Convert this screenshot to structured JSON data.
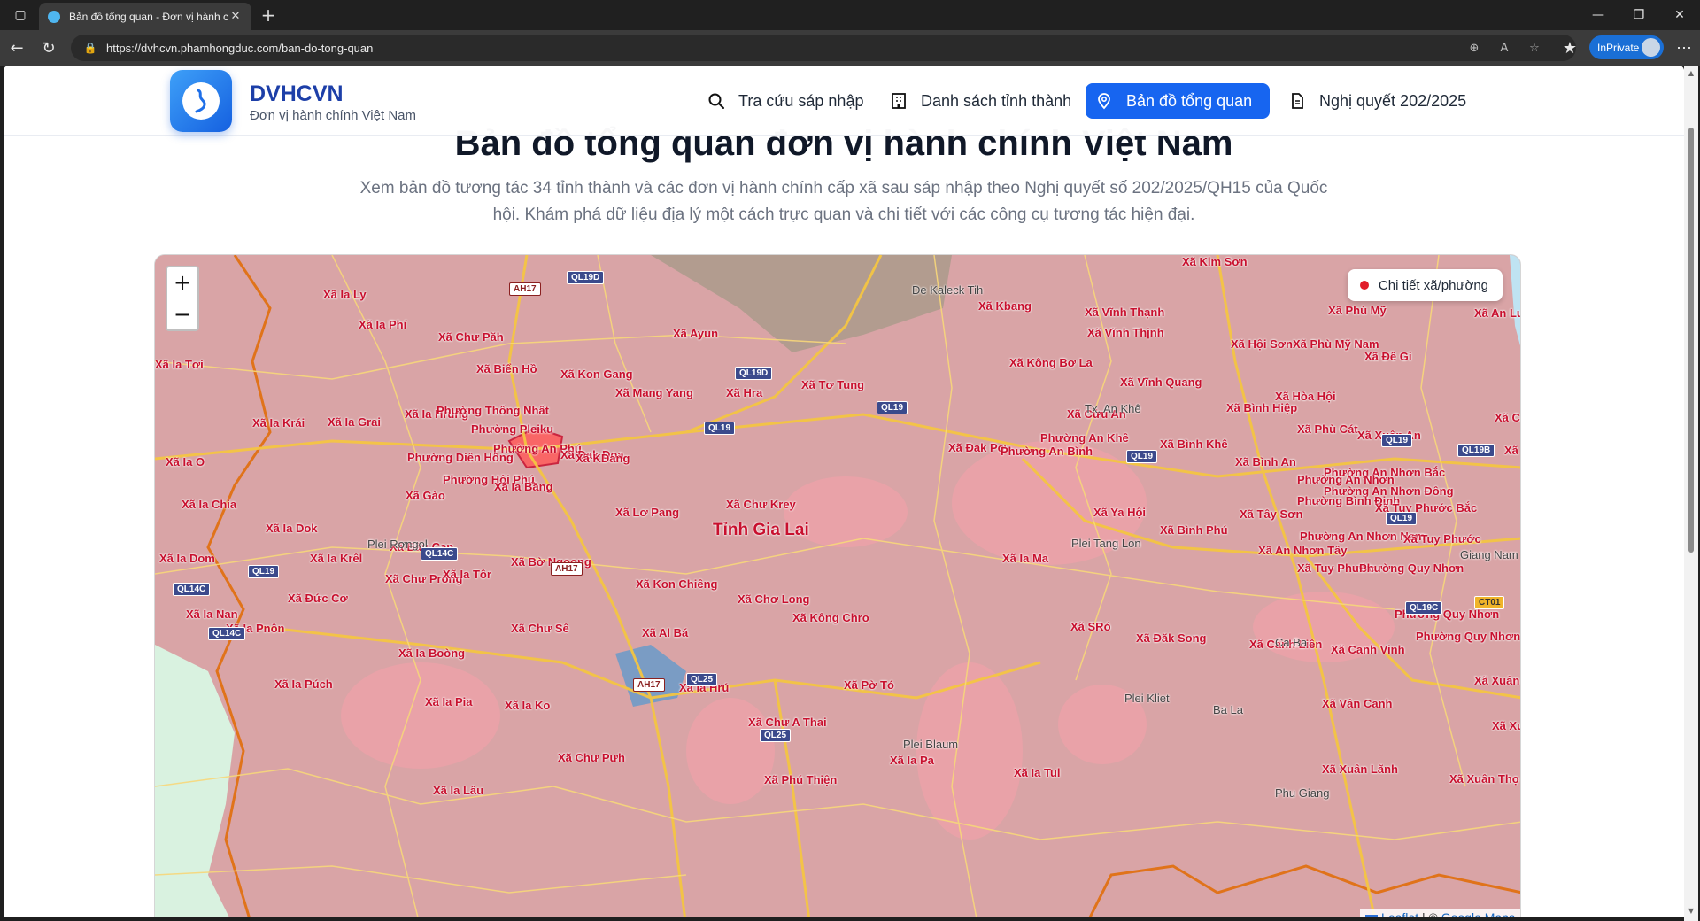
{
  "browser": {
    "tab_title": "Bản đồ tổng quan - Đơn vị hành c",
    "url": "https://dvhcvn.phamhongduc.com/ban-do-tong-quan",
    "inprivate_label": "InPrivate"
  },
  "header": {
    "brand_name": "DVHCVN",
    "brand_subtitle": "Đơn vị hành chính Việt Nam",
    "nav": [
      {
        "label": "Tra cứu sáp nhập",
        "icon": "search-icon"
      },
      {
        "label": "Danh sách tỉnh thành",
        "icon": "building-icon"
      },
      {
        "label": "Bản đồ tổng quan",
        "icon": "map-pin-icon",
        "active": true
      },
      {
        "label": "Nghị quyết 202/2025",
        "icon": "document-icon"
      }
    ],
    "accent_color": "#1765f0"
  },
  "hero": {
    "title": "Bản đồ tổng quan đơn vị hành chính Việt Nam",
    "description": "Xem bản đồ tương tác 34 tỉnh thành và các đơn vị hành chính cấp xã sau sáp nhập theo Nghị quyết số 202/2025/QH15 của Quốc hội. Khám phá dữ liệu địa lý một cách trực quan và chi tiết với các công cụ tương tác hiện đại."
  },
  "map": {
    "zoom_in": "+",
    "zoom_out": "−",
    "legend_label": "Chi tiết xã/phường",
    "attribution_leaflet": "Leaflet",
    "attribution_sep": "| ©",
    "attribution_google": "Google Maps",
    "province_label": "Tỉnh Gia Lai",
    "labels": [
      "Xã Kim Sơn",
      "De Kaleck Tih",
      "Xã Kbang",
      "Xã Vĩnh Thạnh",
      "Xã Phù Mỹ",
      "Xã An Lư",
      "Xã Ia Ly",
      "Xã Ia Phí",
      "Xã Chư Păh",
      "Xã Ayun",
      "Xã Vĩnh Thịnh",
      "Xã Hội Sơn",
      "Xã Phù Mỹ Nam",
      "Xã Đề Gi",
      "Xã Ia Tơi",
      "Xã Biển Hồ",
      "Xã Kon Gang",
      "Xã Kông Bơ La",
      "Xã Mang Yang",
      "Xã Hra",
      "Xã Tơ Tung",
      "Xã Vĩnh Quang",
      "Xã Hòa Hội",
      "Xã Ia Hrung",
      "Phường Thống Nhất",
      "Xã Bình Hiệp",
      "Xã Ia Krái",
      "Xã Ia Grai",
      "Phường Pleiku",
      "Xã Cửu An",
      "Xã Cát",
      "Phường An Khê",
      "Xã Phù Cát",
      "Xã Xuân An",
      "Xã Bình Khê",
      "Phường An Phú",
      "Xã Đak Đoa",
      "Xã Đak Pơ",
      "Phường An Bình",
      "Xã Ng",
      "Xã Ia O",
      "Phường Diên Hồng",
      "Xã KDang",
      "Xã Bình An",
      "Phường An Nhơn Bắc",
      "Phường Hội Phú",
      "Xã Ia Băng",
      "Phường An Nhơn",
      "Phường An Nhơn Đông",
      "Xã Gào",
      "Phường Bình Định",
      "Xã Tuy Phước Bắc",
      "Xã Ia Chia",
      "Xã Lơ Pang",
      "Xã Chư Krey",
      "Xã Ya Hội",
      "Xã Tây Sơn",
      "Xã Ia Dok",
      "Xã Bình Phú",
      "Phường An Nhơn Nam",
      "Xã Tuy Phước",
      "Xã Bàu Cạn",
      "Xã An Nhơn Tây",
      "Xã Ia Dom",
      "Xã Ia Krêl",
      "Xã Bờ Ngoong",
      "Xã Ia Ma",
      "Xã Tuy Phước",
      "Phường Quy Nhơn",
      "Xã Chư Prông",
      "Xã Ia Tôr",
      "Xã Kon Chiêng",
      "Xã Đức Cơ",
      "Xã Chơ Long",
      "Xã Kông Chro",
      "Phường Quy Nhơn",
      "Xã Ia Nan",
      "Xã Ia Pnôn",
      "Xã Chư Sê",
      "Xã Al Bá",
      "Xã SRó",
      "Xã Đăk Song",
      "Xã Canh Liên",
      "Xã Canh Vinh",
      "Phường Quy Nhơn Tây",
      "Xã Ia Boòng",
      "Xã Ia Púch",
      "Xã Pờ Tó",
      "Xã Ia Hrú",
      "Xã Xuân L",
      "Xã Ia Pia",
      "Xã Ia Ko",
      "Xã Chư A Thai",
      "Xã Vân Canh",
      "Xã Xuân",
      "Xã Chư Pưh",
      "Xã Ia Pa",
      "Xã Phú Thiện",
      "Xã Ia Tul",
      "Xã Xuân Lãnh",
      "Xã Xuân Thọ",
      "Xã Ia Lâu"
    ],
    "place_labels": [
      "Plei Rơngol",
      "Plei Tang Lon",
      "Plei Kliet",
      "Plei Blaum",
      "Phu Giang",
      "Ba La",
      "Ca Ba",
      "Tx. An Khê",
      "Giang Nam"
    ],
    "road_shields": [
      "AH17",
      "QL19D",
      "QL19D",
      "QL19",
      "QL19",
      "QL19",
      "QL19",
      "QL19B",
      "QL14C",
      "QL14C",
      "QL14C",
      "QL19",
      "AH17",
      "QL25",
      "AH17",
      "QL25",
      "QL19C",
      "CT01",
      "QL19"
    ]
  }
}
